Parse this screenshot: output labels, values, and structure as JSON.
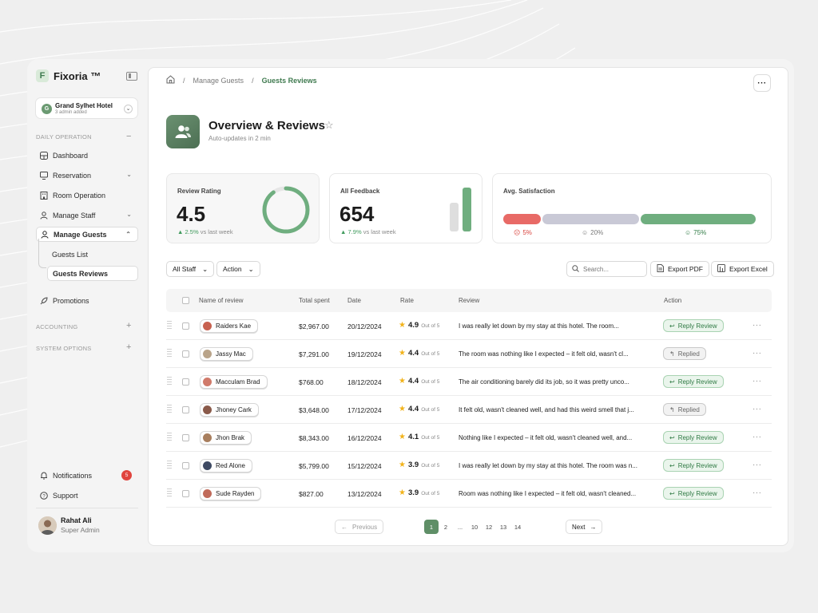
{
  "app": {
    "name": "Fixoria ™",
    "logo_letter": "F"
  },
  "hotel": {
    "name": "Grand Sylhet Hotel",
    "sub": "3 admin added",
    "initial": "G"
  },
  "sidebar": {
    "daily_operation_label": "DAILY OPERATION",
    "items": [
      {
        "label": "Dashboard"
      },
      {
        "label": "Reservation"
      },
      {
        "label": "Room Operation"
      },
      {
        "label": "Manage Staff"
      },
      {
        "label": "Manage Guests"
      }
    ],
    "sub_items": [
      {
        "label": "Guests List"
      },
      {
        "label": "Guests Reviews"
      }
    ],
    "promotions": "Promotions",
    "accounting_label": "ACCOUNTING",
    "system_options_label": "SYSTEM OPTIONS",
    "notifications": {
      "label": "Notifications",
      "count": "5"
    },
    "support": "Support"
  },
  "user": {
    "name": "Rahat Ali",
    "role": "Super Admin"
  },
  "breadcrumb": {
    "items": [
      "Manage Guests"
    ],
    "current": "Guests Reviews"
  },
  "header": {
    "title": "Overview & Reviews",
    "subtitle": "Auto-updates in 2 min"
  },
  "cards": {
    "rating": {
      "label": "Review Rating",
      "value": "4.5",
      "trend": "2.5%",
      "trend_suffix": "vs last week",
      "ring_fraction": 0.9
    },
    "feedback": {
      "label": "All Feedback",
      "value": "654",
      "trend": "7.9%",
      "trend_suffix": "vs last week",
      "bars": [
        0.65,
        1.0
      ]
    },
    "satisfaction": {
      "label": "Avg. Satisfaction",
      "segments": [
        {
          "label": "5%",
          "color": "#e86a66"
        },
        {
          "label": "20%",
          "color": "#c9c9d6"
        },
        {
          "label": "75%",
          "color": "#6fae7f"
        }
      ]
    }
  },
  "filters": {
    "staff": "All Staff",
    "action": "Action"
  },
  "search": {
    "placeholder": "Search..."
  },
  "exports": {
    "pdf": "Export PDF",
    "excel": "Export Excel"
  },
  "table": {
    "headers": {
      "name": "Name of review",
      "spent": "Total spent",
      "date": "Date",
      "rate": "Rate",
      "review": "Review",
      "action": "Action"
    },
    "out_of": "Out of 5",
    "rows": [
      {
        "name": "Raiders Kae",
        "spent": "$2,967.00",
        "date": "20/12/2024",
        "rate": "4.9",
        "review": "I was really let down by my stay at this hotel. The room...",
        "action": "Reply Review",
        "status": "reply",
        "avatar": "#c7614f"
      },
      {
        "name": "Jassy Mac",
        "spent": "$7,291.00",
        "date": "19/12/2024",
        "rate": "4.4",
        "review": "The room was nothing like I expected – it felt old, wasn't cl...",
        "action": "Replied",
        "status": "replied",
        "avatar": "#b9a48a"
      },
      {
        "name": "Macculam Brad",
        "spent": "$768.00",
        "date": "18/12/2024",
        "rate": "4.4",
        "review": "The air conditioning barely did its job, so it was pretty unco...",
        "action": "Reply Review",
        "status": "reply",
        "avatar": "#d07a6a"
      },
      {
        "name": "Jhoney Cark",
        "spent": "$3,648.00",
        "date": "17/12/2024",
        "rate": "4.4",
        "review": "It felt old, wasn't cleaned well, and had this weird smell that j...",
        "action": "Replied",
        "status": "replied",
        "avatar": "#8a5a4a"
      },
      {
        "name": "Jhon Brak",
        "spent": "$8,343.00",
        "date": "16/12/2024",
        "rate": "4.1",
        "review": "Nothing like I expected – it felt old, wasn't cleaned well, and...",
        "action": "Reply Review",
        "status": "reply",
        "avatar": "#a87e5e"
      },
      {
        "name": "Red Alone",
        "spent": "$5,799.00",
        "date": "15/12/2024",
        "rate": "3.9",
        "review": "I was really let down by my stay at this hotel. The room was n...",
        "action": "Reply Review",
        "status": "reply",
        "avatar": "#3e4a63"
      },
      {
        "name": "Sude Rayden",
        "spent": "$827.00",
        "date": "13/12/2024",
        "rate": "3.9",
        "review": "Room was nothing like I expected – it felt old, wasn't cleaned...",
        "action": "Reply Review",
        "status": "reply",
        "avatar": "#c06a5a"
      }
    ]
  },
  "pagination": {
    "previous": "Previous",
    "next": "Next",
    "pages": [
      "1",
      "2",
      "...",
      "10",
      "12",
      "13",
      "14"
    ],
    "current": "1"
  },
  "colors": {
    "accent": "#3f7a4f",
    "accent_light": "#6fae7f",
    "danger": "#e0443e"
  }
}
